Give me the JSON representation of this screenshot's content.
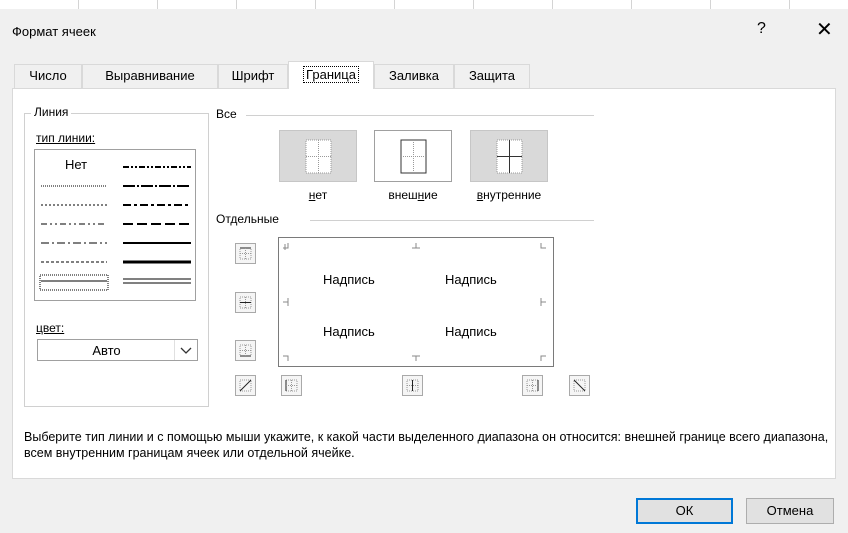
{
  "dialog": {
    "title": "Формат ячеек",
    "help": "?",
    "close": "✕"
  },
  "tabs": [
    {
      "label": "Число"
    },
    {
      "label": "Выравнивание"
    },
    {
      "label": "Шрифт"
    },
    {
      "label": "Граница"
    },
    {
      "label": "Заливка"
    },
    {
      "label": "Защита"
    }
  ],
  "line_group": {
    "legend": "Линия",
    "style_label": "тип линии:",
    "none_label": "Нет",
    "color_label": "цвет:",
    "color_value": "Авто"
  },
  "presets": {
    "legend": "Все",
    "items": [
      {
        "label_pre": "",
        "label_ul": "н",
        "label_post": "ет"
      },
      {
        "label_pre": "внеш",
        "label_ul": "н",
        "label_post": "ие"
      },
      {
        "label_pre": "",
        "label_ul": "в",
        "label_post": "нутренние"
      }
    ]
  },
  "border": {
    "legend": "Отдельные",
    "sample_text": "Надпись"
  },
  "description": "Выберите тип линии и с помощью мыши укажите, к какой части выделенного диапазона он относится: внешней границе всего диапазона, всем внутренним границам ячеек или отдельной ячейке.",
  "buttons": {
    "ok": "ОК",
    "cancel": "Отмена"
  },
  "colors": {
    "accent": "#0078d7"
  }
}
